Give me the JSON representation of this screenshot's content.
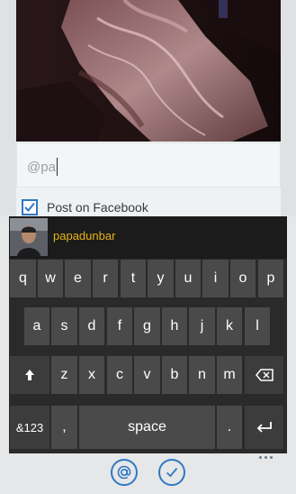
{
  "caption": {
    "value": "@pa"
  },
  "facebook": {
    "label": "Post on Facebook",
    "checked": true
  },
  "suggestion": {
    "username": "papadunbar"
  },
  "keyboard": {
    "row1": [
      "q",
      "w",
      "e",
      "r",
      "t",
      "y",
      "u",
      "i",
      "o",
      "p"
    ],
    "row2": [
      "a",
      "s",
      "d",
      "f",
      "g",
      "h",
      "j",
      "k",
      "l"
    ],
    "row3": [
      "z",
      "x",
      "c",
      "v",
      "b",
      "n",
      "m"
    ],
    "numbers_label": "&123",
    "comma_label": ",",
    "space_label": "space",
    "period_label": "."
  },
  "appbar": {
    "mention_icon": "at-icon",
    "confirm_icon": "checkmark-icon",
    "more_icon": "ellipsis-icon"
  },
  "colors": {
    "accent": "#2f78c4",
    "suggestion_text": "#e6b414",
    "key_bg": "#4a4a4a",
    "keyboard_bg": "#2a2a2a"
  }
}
